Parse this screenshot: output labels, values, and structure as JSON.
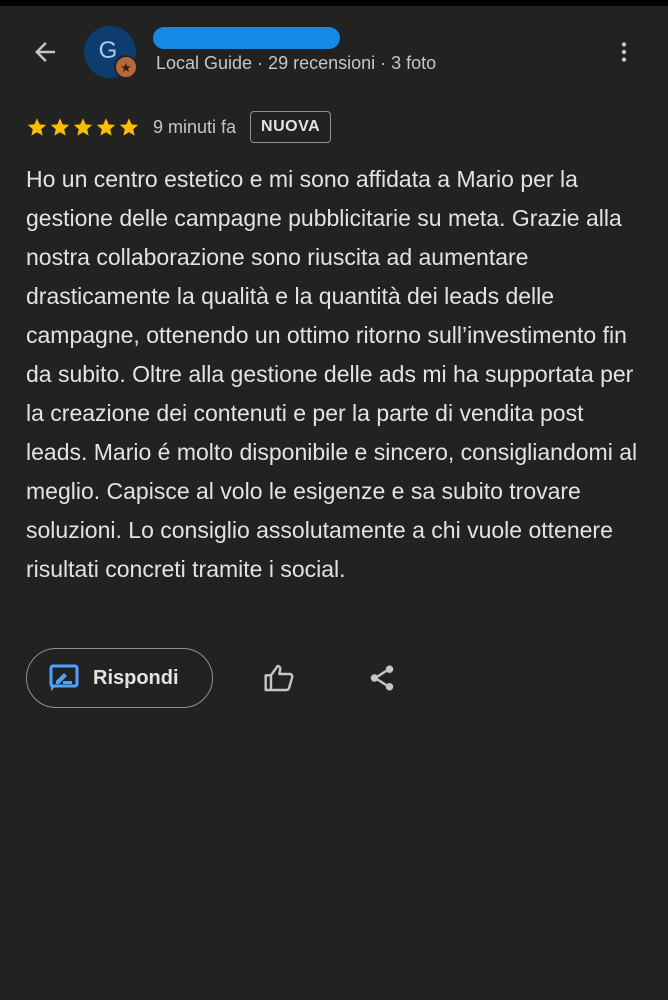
{
  "header": {
    "back_icon": "arrow-left-icon",
    "avatar_letter": "G",
    "avatar_color": "#0c3d6e",
    "badge_icon": "local-guide-star-icon",
    "badge_color": "#b36a3c",
    "name_redaction_color": "#1689e6",
    "meta": "Local Guide · 29 recensioni · 3 foto",
    "more_icon": "more-vert-icon"
  },
  "review": {
    "stars": 5,
    "star_color": "#fbbc04",
    "time": "9 minuti fa",
    "badge": "NUOVA",
    "text": "Ho un centro estetico e mi sono affidata a Mario per la gestione delle campagne pubblicitarie su meta. Grazie alla nostra collaborazione sono riuscita ad aumentare drasticamente la qualità e la quantità dei leads delle campagne, ottenendo un ottimo ritorno sull’investimento fin da subito. Oltre alla gestione delle ads mi ha supportata per la creazione dei contenuti e per la parte di vendita post leads. Mario é molto disponibile e sincero, consigliandomi al meglio. Capisce al volo le esigenze e sa subito trovare soluzioni. Lo consiglio assolutamente a chi vuole ottenere risultati concreti tramite i social."
  },
  "actions": {
    "reply_icon": "rate-review-icon",
    "reply_label": "Rispondi",
    "reply_icon_color": "#4da3ff",
    "like_icon": "thumb-up-icon",
    "share_icon": "share-icon"
  }
}
